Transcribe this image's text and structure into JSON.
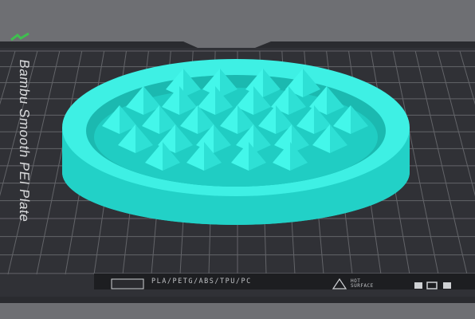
{
  "viewport": {
    "plate_label": "Bambu Smooth PEI Plate",
    "materials_text": "PLA/PETG/ABS/TPU/PC",
    "surface_text_line1": "HOT",
    "surface_text_line2": "SURFACE",
    "model": {
      "name": "spiked-dish",
      "color": "#27e0d6"
    },
    "colors": {
      "background": "#6e6f73",
      "plate": "#2c2d31",
      "grid": "#7c7e82",
      "model_top": "#3ef2e6",
      "model_side": "#1fcfc5"
    }
  }
}
